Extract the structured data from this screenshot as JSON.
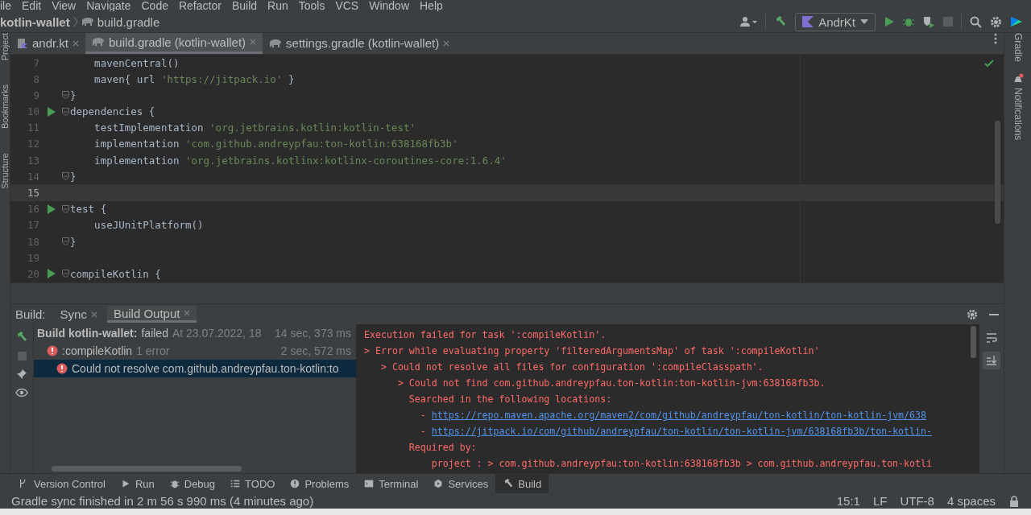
{
  "menu": [
    "ile",
    "Edit",
    "View",
    "Navigate",
    "Code",
    "Refactor",
    "Build",
    "Run",
    "Tools",
    "VCS",
    "Window",
    "Help"
  ],
  "breadcrumb": {
    "project": "kotlin-wallet",
    "file": "build.gradle"
  },
  "toolbar": {
    "run_config": "AndrKt"
  },
  "tabs": [
    {
      "label": "andr.kt",
      "kind": "kotlin",
      "selected": false
    },
    {
      "label": "build.gradle (kotlin-wallet)",
      "kind": "gradle",
      "selected": true
    },
    {
      "label": "settings.gradle (kotlin-wallet)",
      "kind": "gradle",
      "selected": false
    }
  ],
  "left_strip": [
    "Project",
    "Bookmarks",
    "Structure"
  ],
  "right_strip": [
    "Gradle",
    "Notifications"
  ],
  "editor": {
    "lines": [
      {
        "number": "7",
        "run": false,
        "fold": false,
        "current": false,
        "code": [
          {
            "text": "    mavenCentral()",
            "kind": "plain"
          }
        ]
      },
      {
        "number": "8",
        "run": false,
        "fold": false,
        "current": false,
        "code": [
          {
            "text": "    maven{ url ",
            "kind": "plain"
          },
          {
            "text": "'https://jitpack.io'",
            "kind": "string"
          },
          {
            "text": " }",
            "kind": "plain"
          }
        ]
      },
      {
        "number": "9",
        "run": false,
        "fold": true,
        "current": false,
        "code": [
          {
            "text": "}",
            "kind": "plain"
          }
        ]
      },
      {
        "number": "10",
        "run": true,
        "fold": true,
        "current": false,
        "code": [
          {
            "text": "dependencies {",
            "kind": "plain"
          }
        ]
      },
      {
        "number": "11",
        "run": false,
        "fold": false,
        "current": false,
        "code": [
          {
            "text": "    testImplementation ",
            "kind": "plain"
          },
          {
            "text": "'org.jetbrains.kotlin:kotlin-test'",
            "kind": "string"
          }
        ]
      },
      {
        "number": "12",
        "run": false,
        "fold": false,
        "current": false,
        "code": [
          {
            "text": "    implementation ",
            "kind": "plain"
          },
          {
            "text": "'com.github.andreypfau:ton-kotlin:638168fb3b'",
            "kind": "string"
          }
        ]
      },
      {
        "number": "13",
        "run": false,
        "fold": false,
        "current": false,
        "code": [
          {
            "text": "    implementation ",
            "kind": "plain"
          },
          {
            "text": "'org.jetbrains.kotlinx:kotlinx-coroutines-core:1.6.4'",
            "kind": "string"
          }
        ]
      },
      {
        "number": "14",
        "run": false,
        "fold": true,
        "current": false,
        "code": [
          {
            "text": "}",
            "kind": "plain"
          }
        ]
      },
      {
        "number": "15",
        "run": false,
        "fold": false,
        "current": true
      },
      {
        "number": "16",
        "run": true,
        "fold": true,
        "current": false,
        "code": [
          {
            "text": "test {",
            "kind": "plain"
          }
        ]
      },
      {
        "number": "17",
        "run": false,
        "fold": false,
        "current": false,
        "code": [
          {
            "text": "    useJUnitPlatform()",
            "kind": "plain"
          }
        ]
      },
      {
        "number": "18",
        "run": false,
        "fold": true,
        "current": false,
        "code": [
          {
            "text": "}",
            "kind": "plain"
          }
        ]
      },
      {
        "number": "19",
        "run": false,
        "fold": false,
        "current": false
      },
      {
        "number": "20",
        "run": true,
        "fold": true,
        "current": false,
        "code": [
          {
            "text": "compileKotlin {",
            "kind": "plain"
          }
        ]
      }
    ]
  },
  "build_panel": {
    "label": "Build:",
    "tabs": [
      {
        "label": "Sync",
        "selected": false
      },
      {
        "label": "Build Output",
        "selected": true
      }
    ],
    "tree": [
      {
        "title": "Build kotlin-wallet:",
        "status": "failed",
        "timestamp": "At 23.07.2022, 18",
        "duration": "14 sec, 373 ms",
        "error": false,
        "selected": false,
        "children": [
          {
            "title": ":compileKotlin",
            "note": "1 error",
            "duration": "2 sec, 572 ms",
            "error": true,
            "selected": false,
            "children": [
              {
                "title": "Could not resolve com.github.andreypfau.ton-kotlin:to",
                "error": true,
                "selected": true
              }
            ]
          }
        ]
      }
    ],
    "console": [
      [
        {
          "text": "Execution failed for task ':compileKotlin'.",
          "kind": "error"
        }
      ],
      [
        {
          "text": "> Error while evaluating property 'filteredArgumentsMap' of task ':compileKotlin'",
          "kind": "error"
        }
      ],
      [
        {
          "text": "   > Could not resolve all files for configuration ':compileClasspath'.",
          "kind": "error"
        }
      ],
      [
        {
          "text": "      > Could not find com.github.andreypfau.ton-kotlin:ton-kotlin-jvm:638168fb3b.",
          "kind": "error"
        }
      ],
      [
        {
          "text": "        Searched in the following locations:",
          "kind": "error"
        }
      ],
      [
        {
          "text": "          - ",
          "kind": "error"
        },
        {
          "text": "https://repo.maven.apache.org/maven2/com/github/andreypfau/ton-kotlin/ton-kotlin-jvm/638",
          "kind": "link"
        }
      ],
      [
        {
          "text": "          - ",
          "kind": "error"
        },
        {
          "text": "https://jitpack.io/com/github/andreypfau/ton-kotlin/ton-kotlin-jvm/638168fb3b/ton-kotlin-",
          "kind": "link"
        }
      ],
      [
        {
          "text": "        Required by:",
          "kind": "error"
        }
      ],
      [
        {
          "text": "            project : > com.github.andreypfau:ton-kotlin:638168fb3b > com.github.andreypfau.ton-kotli",
          "kind": "error"
        }
      ]
    ]
  },
  "tool_windows": [
    {
      "label": "Version Control",
      "kind": "vcs",
      "selected": false
    },
    {
      "label": "Run",
      "kind": "run",
      "selected": false
    },
    {
      "label": "Debug",
      "kind": "debug",
      "selected": false
    },
    {
      "label": "TODO",
      "kind": "todo",
      "selected": false
    },
    {
      "label": "Problems",
      "kind": "problems",
      "selected": false
    },
    {
      "label": "Terminal",
      "kind": "terminal",
      "selected": false
    },
    {
      "label": "Services",
      "kind": "services",
      "selected": false
    },
    {
      "label": "Build",
      "kind": "build",
      "selected": true
    }
  ],
  "status_bar": {
    "message": "Gradle sync finished in 2 m 56 s 990 ms (4 minutes ago)",
    "items": [
      "15:1",
      "LF",
      "UTF-8",
      "4 spaces"
    ]
  }
}
